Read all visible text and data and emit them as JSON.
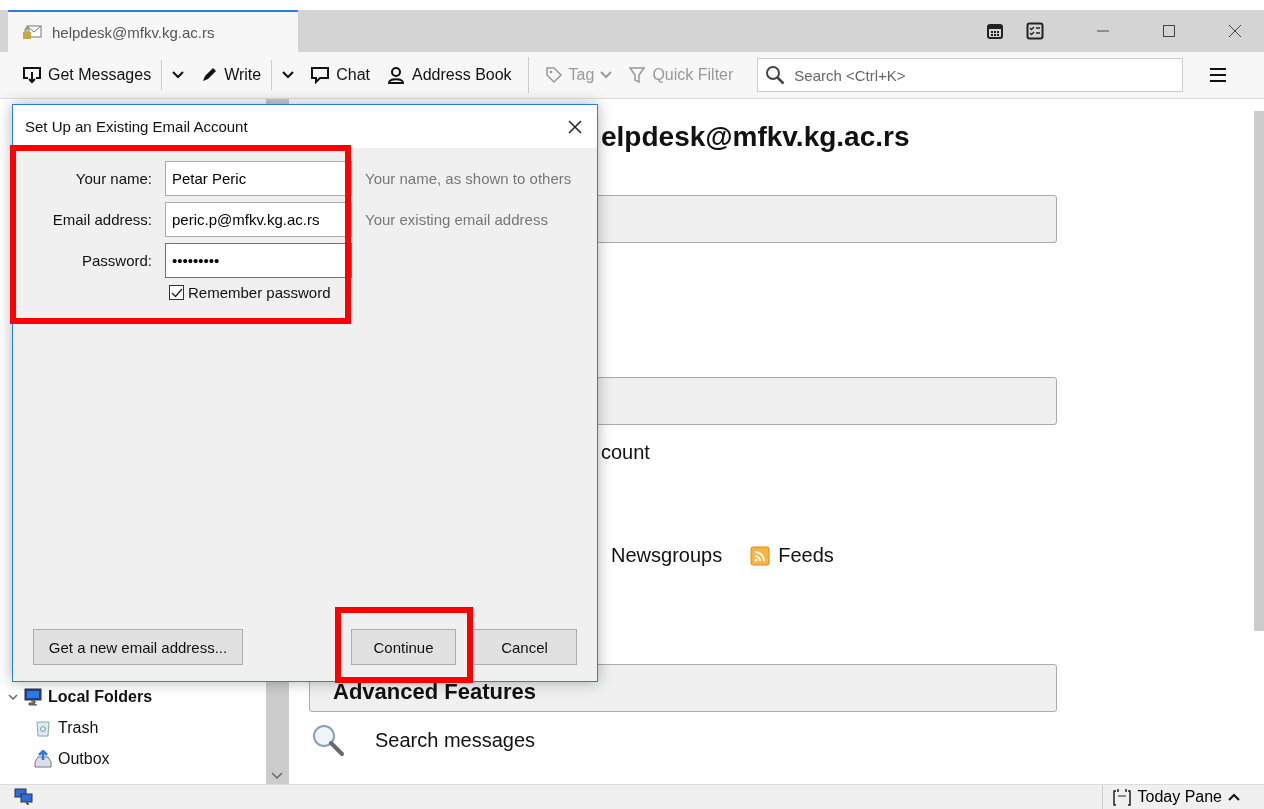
{
  "window": {
    "tabs": [
      {
        "title": "helpdesk@mfkv.kg.ac.rs",
        "selected": true
      }
    ]
  },
  "toolbar": {
    "buttons": [
      {
        "label": "Get Messages",
        "disabled": false,
        "menu": true
      },
      {
        "label": "Write",
        "disabled": false,
        "menu": true
      },
      {
        "label": "Chat",
        "disabled": false,
        "menu": false
      },
      {
        "label": "Address Book",
        "disabled": false,
        "menu": false
      },
      {
        "label": "Tag",
        "disabled": true,
        "menu": true
      },
      {
        "label": "Quick Filter",
        "disabled": true,
        "menu": false
      }
    ],
    "search": {
      "placeholder": "Search <Ctrl+K>"
    }
  },
  "folder_pane": {
    "folders": [
      {
        "name": "Local Folders",
        "expanded": true,
        "children": [
          {
            "name": "Trash"
          },
          {
            "name": "Outbox"
          }
        ]
      }
    ]
  },
  "account_central": {
    "heading": "elpdesk@mfkv.kg.ac.rs",
    "partial_text": "count",
    "links": [
      "Newsgroups",
      "Feeds"
    ],
    "section": "Advanced Features",
    "actions": [
      "Search messages"
    ]
  },
  "dialog": {
    "title": "Set Up an Existing Email Account",
    "fields": [
      {
        "label": "Your name:",
        "value": "Petar Peric",
        "hint": "Your name, as shown to others",
        "focused": false
      },
      {
        "label": "Email address:",
        "value": "peric.p@mfkv.kg.ac.rs",
        "hint": "Your existing email address",
        "focused": false
      },
      {
        "label": "Password:",
        "value": "•••••••••",
        "focused": true
      }
    ],
    "remember": {
      "label": "Remember password",
      "checked": true
    },
    "buttons": [
      {
        "label": "Get a new email address..."
      },
      {
        "label": "Continue"
      },
      {
        "label": "Cancel"
      }
    ]
  },
  "status_bar": {
    "today_pane": "Today Pane"
  }
}
